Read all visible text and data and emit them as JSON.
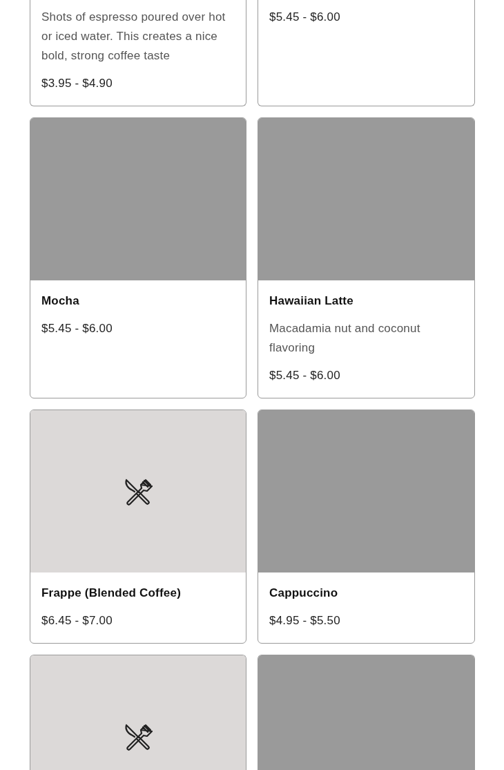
{
  "menu_items": [
    {
      "cut_top": true,
      "description": "Shots of espresso poured over hot or iced water. This creates a nice bold, strong coffee taste",
      "price": "$3.95 - $4.90"
    },
    {
      "cut_top": true,
      "price": "$5.45 - $6.00"
    },
    {
      "kind": "image",
      "name": "Mocha",
      "price": "$5.45 - $6.00"
    },
    {
      "kind": "image",
      "name": "Hawaiian Latte",
      "description": "Macadamia nut and coconut flavoring",
      "price": "$5.45 - $6.00"
    },
    {
      "kind": "placeholder",
      "name": "Frappe (Blended Coffee)",
      "price": "$6.45 - $7.00"
    },
    {
      "kind": "image",
      "name": "Cappuccino",
      "price": "$4.95 - $5.50"
    },
    {
      "kind": "placeholder",
      "cut_bottom": true
    },
    {
      "kind": "image",
      "cut_bottom": true
    }
  ]
}
